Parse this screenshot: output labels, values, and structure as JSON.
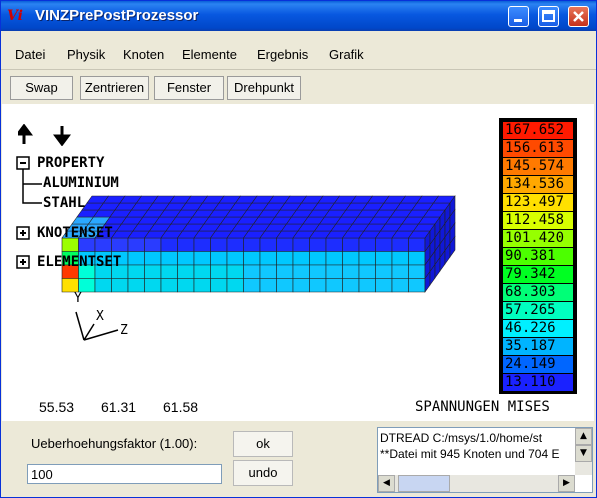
{
  "window": {
    "title": "VINZPrePostProzessor",
    "app_icon_text": "Vi",
    "controls": [
      "minimize-icon",
      "maximize-icon",
      "close-icon"
    ]
  },
  "menu": {
    "items": [
      "Datei",
      "Physik",
      "Knoten",
      "Elemente",
      "Ergebnis",
      "Grafik"
    ]
  },
  "toolbar": {
    "buttons": [
      "Swap",
      "Zentrieren",
      "Fenster",
      "Drehpunkt"
    ]
  },
  "viewport": {
    "tree": {
      "property": "PROPERTY",
      "aluminium": "ALUMINIUM",
      "stahl": "STAHL",
      "knotenset": "KNOTENSET",
      "elementset": "ELEMENTSET",
      "collapse_symbol": "−",
      "expand_symbol": "+"
    },
    "axes": {
      "x": "X",
      "y": "Y",
      "z": "Z"
    },
    "coords": [
      "55.53",
      "61.31",
      "61.58"
    ],
    "result_label": "SPANNUNGEN MISES",
    "legend": [
      {
        "value": "167.652",
        "color": "#ff1a00"
      },
      {
        "value": "156.613",
        "color": "#ff4a00"
      },
      {
        "value": "145.574",
        "color": "#ff7a00"
      },
      {
        "value": "134.536",
        "color": "#ffa800"
      },
      {
        "value": "123.497",
        "color": "#ffe000"
      },
      {
        "value": "112.458",
        "color": "#d8ff00"
      },
      {
        "value": "101.420",
        "color": "#96ff00"
      },
      {
        "value": "90.381",
        "color": "#4cff00"
      },
      {
        "value": "79.342",
        "color": "#00ff22"
      },
      {
        "value": "68.303",
        "color": "#00ff77"
      },
      {
        "value": "57.265",
        "color": "#00ffc0"
      },
      {
        "value": "46.226",
        "color": "#00f0ff"
      },
      {
        "value": "35.187",
        "color": "#00b4ff"
      },
      {
        "value": "24.149",
        "color": "#0066ff"
      },
      {
        "value": "13.110",
        "color": "#1a22ff"
      }
    ]
  },
  "bottom": {
    "factor_label": "Ueberhoehungsfaktor (1.00):",
    "factor_value": "100",
    "ok_label": "ok",
    "undo_label": "undo",
    "log_lines": [
      "DTREAD C:/msys/1.0/home/st",
      "**Datei mit 945 Knoten und 704 E"
    ]
  }
}
